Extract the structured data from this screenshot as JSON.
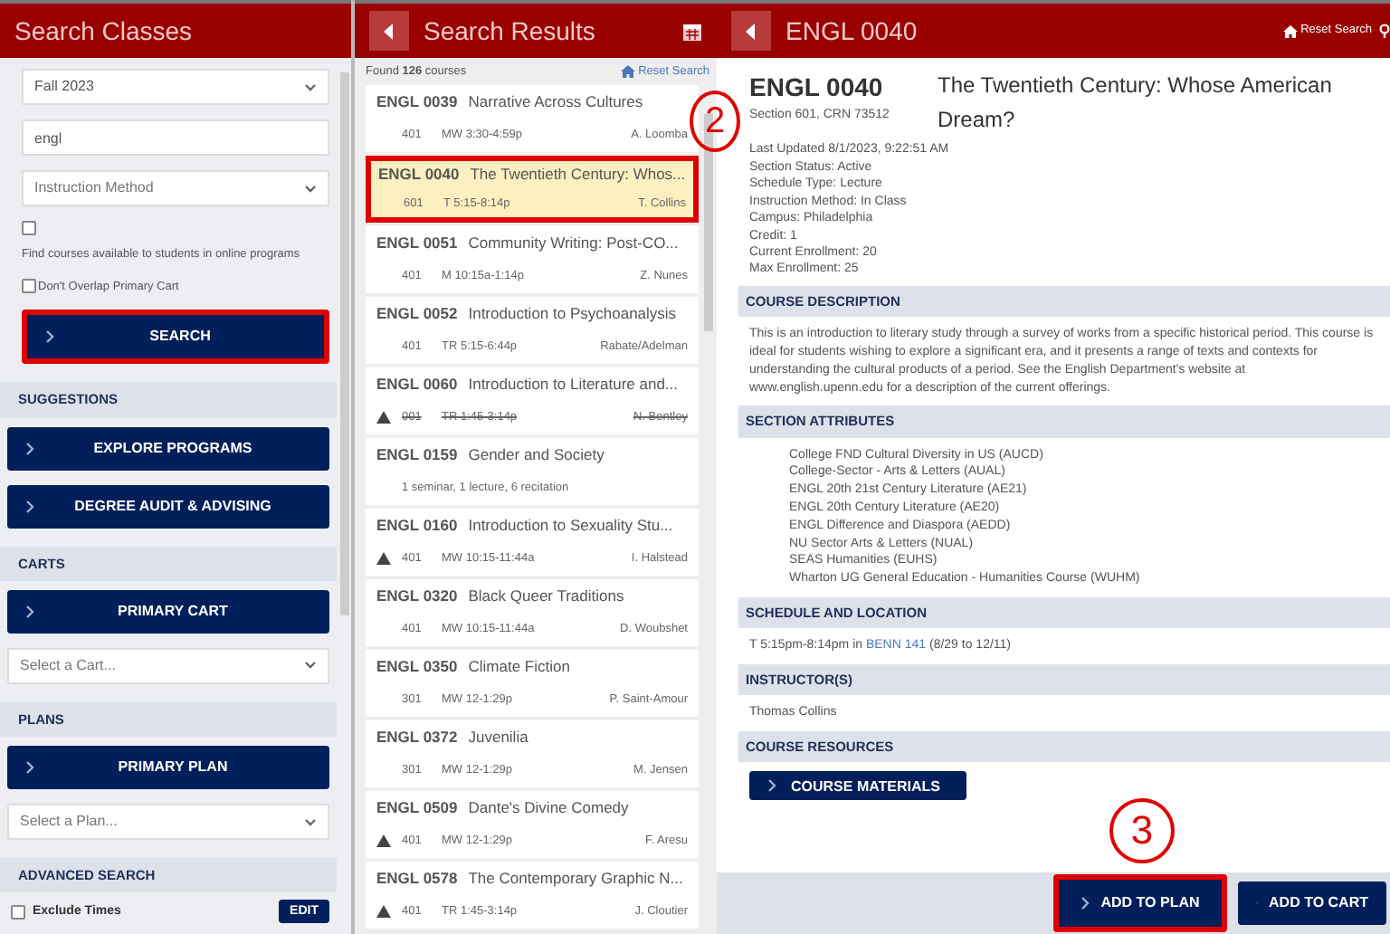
{
  "search_panel": {
    "title": "Search Classes",
    "term_select": {
      "value": "Fall 2023"
    },
    "keyword_field": {
      "value": "engl"
    },
    "method_select": {
      "placeholder": "Instruction Method"
    },
    "online_option": {
      "label": "Find courses available to students in online programs",
      "checked": false
    },
    "overlap_option": {
      "label": "Don't Overlap Primary Cart",
      "checked": false
    },
    "search_button": {
      "label": "SEARCH",
      "highlighted": true
    },
    "sections": [
      {
        "heading": "SUGGESTIONS",
        "items": [
          {
            "kind": "button",
            "label": "EXPLORE PROGRAMS"
          },
          {
            "kind": "button",
            "label": "DEGREE AUDIT & ADVISING"
          }
        ]
      },
      {
        "heading": "CARTS",
        "items": [
          {
            "kind": "button",
            "label": "PRIMARY CART"
          },
          {
            "kind": "select",
            "placeholder": "Select a Cart..."
          }
        ]
      },
      {
        "heading": "PLANS",
        "items": [
          {
            "kind": "button",
            "label": "PRIMARY PLAN"
          },
          {
            "kind": "select",
            "placeholder": "Select a Plan..."
          }
        ]
      },
      {
        "heading": "ADVANCED SEARCH",
        "items": [
          {
            "kind": "option",
            "label": "Exclude Times",
            "checked": false,
            "action": "EDIT"
          }
        ]
      }
    ]
  },
  "results_panel": {
    "title": "Search Results",
    "found": "Found **126** courses",
    "reset_link": "Reset Search",
    "rows": [
      {
        "code": "ENGL 0039",
        "title": "Narrative Across Cultures",
        "kind": "section",
        "section": "401",
        "time": "MW 3:30-4:59p",
        "instructor": "A. Loomba",
        "warning": false,
        "cancelled": false,
        "selected": false
      },
      {
        "code": "ENGL 0040",
        "title": "The Twentieth Century: Whos...",
        "kind": "section",
        "section": "601",
        "time": "T 5:15-8:14p",
        "instructor": "T. Collins",
        "warning": false,
        "cancelled": false,
        "selected": true
      },
      {
        "code": "ENGL 0051",
        "title": "Community Writing: Post-CO...",
        "kind": "section",
        "section": "401",
        "time": "M 10:15a-1:14p",
        "instructor": "Z. Nunes",
        "warning": false,
        "cancelled": false,
        "selected": false
      },
      {
        "code": "ENGL 0052",
        "title": "Introduction to Psychoanalysis",
        "kind": "section",
        "section": "401",
        "time": "TR 5:15-6:44p",
        "instructor": "Rabate/Adelman",
        "warning": false,
        "cancelled": false,
        "selected": false
      },
      {
        "code": "ENGL 0060",
        "title": "Introduction to Literature and...",
        "kind": "section",
        "section": "001",
        "time": "TR 1:45-3:14p",
        "instructor": "N. Bentley",
        "warning": true,
        "cancelled": true,
        "selected": false
      },
      {
        "code": "ENGL 0159",
        "title": "Gender and Society",
        "kind": "note",
        "note": "1 seminar, 1 lecture, 6 recitation",
        "selected": false
      },
      {
        "code": "ENGL 0160",
        "title": "Introduction to Sexuality Stu...",
        "kind": "section",
        "section": "401",
        "time": "MW 10:15-11:44a",
        "instructor": "I. Halstead",
        "warning": true,
        "cancelled": false,
        "selected": false
      },
      {
        "code": "ENGL 0320",
        "title": "Black Queer Traditions",
        "kind": "section",
        "section": "401",
        "time": "MW 10:15-11:44a",
        "instructor": "D. Woubshet",
        "warning": false,
        "cancelled": false,
        "selected": false
      },
      {
        "code": "ENGL 0350",
        "title": "Climate Fiction",
        "kind": "section",
        "section": "301",
        "time": "MW 12-1:29p",
        "instructor": "P. Saint-Amour",
        "warning": false,
        "cancelled": false,
        "selected": false
      },
      {
        "code": "ENGL 0372",
        "title": "Juvenilia",
        "kind": "section",
        "section": "301",
        "time": "MW 12-1:29p",
        "instructor": "M. Jensen",
        "warning": false,
        "cancelled": false,
        "selected": false
      },
      {
        "code": "ENGL 0509",
        "title": "Dante's Divine Comedy",
        "kind": "section",
        "section": "401",
        "time": "MW 12-1:29p",
        "instructor": "F. Aresu",
        "warning": true,
        "cancelled": false,
        "selected": false
      },
      {
        "code": "ENGL 0578",
        "title": "The Contemporary Graphic N...",
        "kind": "section",
        "section": "401",
        "time": "TR 1:45-3:14p",
        "instructor": "J. Cloutier",
        "warning": true,
        "cancelled": false,
        "selected": false
      }
    ]
  },
  "detail_panel": {
    "title": "ENGL 0040",
    "reset_link": "Reset Search",
    "code": "ENGL 0040",
    "course_title": "The Twentieth Century: Whose American Dream?",
    "section_line": "Section 601, CRN 73512",
    "callout": "2",
    "facts": [
      "Last Updated 8/1/2023, 9:22:51 AM",
      "Section Status: Active",
      "Schedule Type: Lecture",
      "Instruction Method: In Class",
      "Campus: Philadelphia",
      "Credit: 1",
      "Current Enrollment: 20",
      "Max Enrollment: 25"
    ],
    "blocks": [
      {
        "heading": "COURSE DESCRIPTION",
        "kind": "text",
        "text": "This is an introduction to literary study through a survey of works from a specific historical period. This course is ideal for students wishing to explore a significant era, and it presents a range of texts and contexts for understanding the cultural products of a period. See the English Department's website at www.english.upenn.edu for a description of the current offerings."
      },
      {
        "heading": "SECTION ATTRIBUTES",
        "kind": "list",
        "items": [
          "College FND Cultural Diversity in US (AUCD)",
          "College-Sector - Arts & Letters (AUAL)",
          "ENGL 20th 21st Century Literature (AE21)",
          "ENGL 20th Century Literature (AE20)",
          "ENGL Difference and Diaspora (AEDD)",
          "NU Sector Arts & Letters (NUAL)",
          "SEAS Humanities (EUHS)",
          "Wharton UG General Education - Humanities Course (WUHM)"
        ]
      },
      {
        "heading": "SCHEDULE AND LOCATION",
        "kind": "schedule",
        "before": "T 5:15pm-8:14pm in",
        "link": "BENN 141",
        "after": "(8/29 to 12/11)"
      },
      {
        "heading": "INSTRUCTOR(S)",
        "kind": "text",
        "text": "Thomas Collins"
      },
      {
        "heading": "COURSE RESOURCES",
        "kind": "button",
        "label": "COURSE MATERIALS"
      }
    ],
    "footer": {
      "callout": "3",
      "buttons": [
        {
          "label": "ADD TO PLAN",
          "highlighted": true
        },
        {
          "label": "ADD TO CART",
          "highlighted": false
        }
      ]
    }
  }
}
